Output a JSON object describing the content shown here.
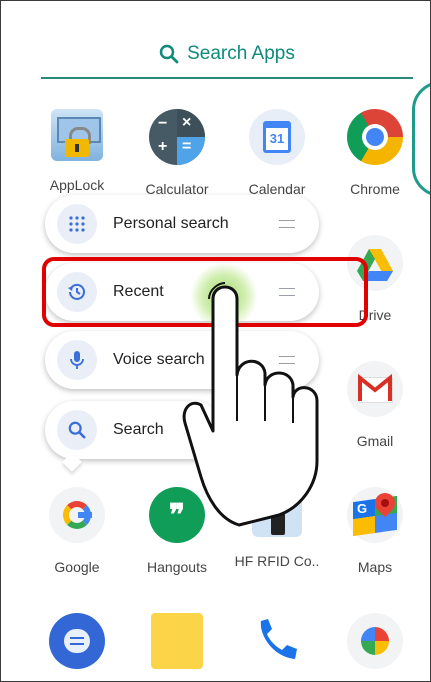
{
  "search": {
    "label": "Search Apps",
    "icon": "search-icon",
    "accent": "#0f8a7b"
  },
  "apps": [
    {
      "label": "AppLock",
      "icon": "applock-icon"
    },
    {
      "label": "Calculator",
      "icon": "calculator-icon"
    },
    {
      "label": "Calendar",
      "icon": "calendar-icon",
      "day": "31"
    },
    {
      "label": "Chrome",
      "icon": "chrome-icon"
    },
    {
      "label": "Drive",
      "icon": "drive-icon"
    },
    {
      "label": "Gmail",
      "icon": "gmail-icon"
    },
    {
      "label": "Google",
      "icon": "google-icon"
    },
    {
      "label": "Hangouts",
      "icon": "hangouts-icon"
    },
    {
      "label": "HF RFID Co..",
      "icon": "hf-rfid-icon"
    },
    {
      "label": "Maps",
      "icon": "maps-icon"
    },
    {
      "label": "",
      "icon": "messages-icon"
    },
    {
      "label": "",
      "icon": "keep-notes-icon"
    },
    {
      "label": "",
      "icon": "phone-icon"
    },
    {
      "label": "",
      "icon": "photos-icon"
    }
  ],
  "shortcuts": [
    {
      "label": "Personal search",
      "icon": "grid-dots-icon"
    },
    {
      "label": "Recent",
      "icon": "history-icon"
    },
    {
      "label": "Voice search",
      "icon": "microphone-icon"
    },
    {
      "label": "Search",
      "icon": "search-icon"
    }
  ],
  "colors": {
    "highlight": "#e00000",
    "shortcut_icon_bg": "#e9eef7",
    "shortcut_icon_fg": "#3b6fd8"
  }
}
